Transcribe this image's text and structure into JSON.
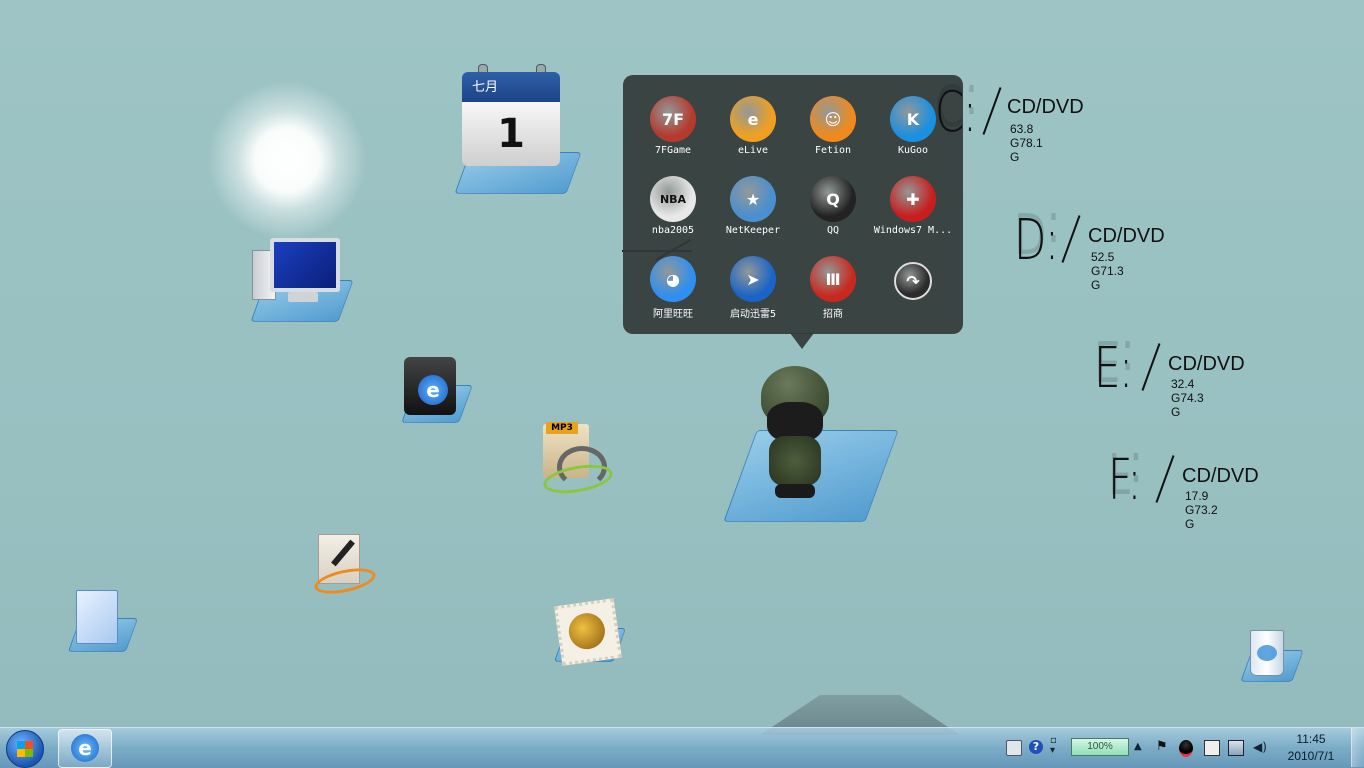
{
  "calendar": {
    "month": "七月",
    "day": "1"
  },
  "popup": {
    "apps": [
      {
        "label": "7FGame",
        "icon": "7fgame-icon",
        "color": "#b53a2e",
        "glyph": "7F"
      },
      {
        "label": "eLive",
        "icon": "elive-icon",
        "color": "#f0a020",
        "glyph": "e"
      },
      {
        "label": "Fetion",
        "icon": "fetion-icon",
        "color": "#f08a1c",
        "glyph": "☺"
      },
      {
        "label": "KuGoo",
        "icon": "kugoo-icon",
        "color": "#1b8fe0",
        "glyph": "K"
      },
      {
        "label": "nba2005",
        "icon": "nba-icon",
        "color": "#e8e8e8",
        "glyph": "NBA"
      },
      {
        "label": "NetKeeper",
        "icon": "netkeeper-icon",
        "color": "#4a8fcf",
        "glyph": "★"
      },
      {
        "label": "QQ",
        "icon": "qq-penguin-icon",
        "color": "#222222",
        "glyph": "Q"
      },
      {
        "label": "Windows7 M...",
        "icon": "swiss-knife-icon",
        "color": "#c81e1e",
        "glyph": "✚"
      },
      {
        "label": "阿里旺旺",
        "icon": "aliwangwang-icon",
        "color": "#2f8ff0",
        "glyph": "◕"
      },
      {
        "label": "启动迅雷5",
        "icon": "thunder-icon",
        "color": "#1a64c8",
        "glyph": "➤"
      },
      {
        "label": "招商",
        "icon": "cmb-icon",
        "color": "#c8291e",
        "glyph": "Ⅲ"
      },
      {
        "label": "",
        "icon": "share-arrow-icon",
        "color": "#2b2b2b",
        "glyph": "↷"
      }
    ]
  },
  "drives": [
    {
      "letter": "C:",
      "type": "CD/DVD",
      "size": "63.8 G78.1 G"
    },
    {
      "letter": "D:",
      "type": "CD/DVD",
      "size": "52.5 G71.3 G"
    },
    {
      "letter": "E:",
      "type": "CD/DVD",
      "size": "32.4 G74.3 G"
    },
    {
      "letter": "F:",
      "type": "CD/DVD",
      "size": "17.9 G73.2 G"
    }
  ],
  "mp3": {
    "label": "MP3"
  },
  "taskbar": {
    "battery": "100%",
    "time": "11:45",
    "date": "2010/7/1"
  }
}
